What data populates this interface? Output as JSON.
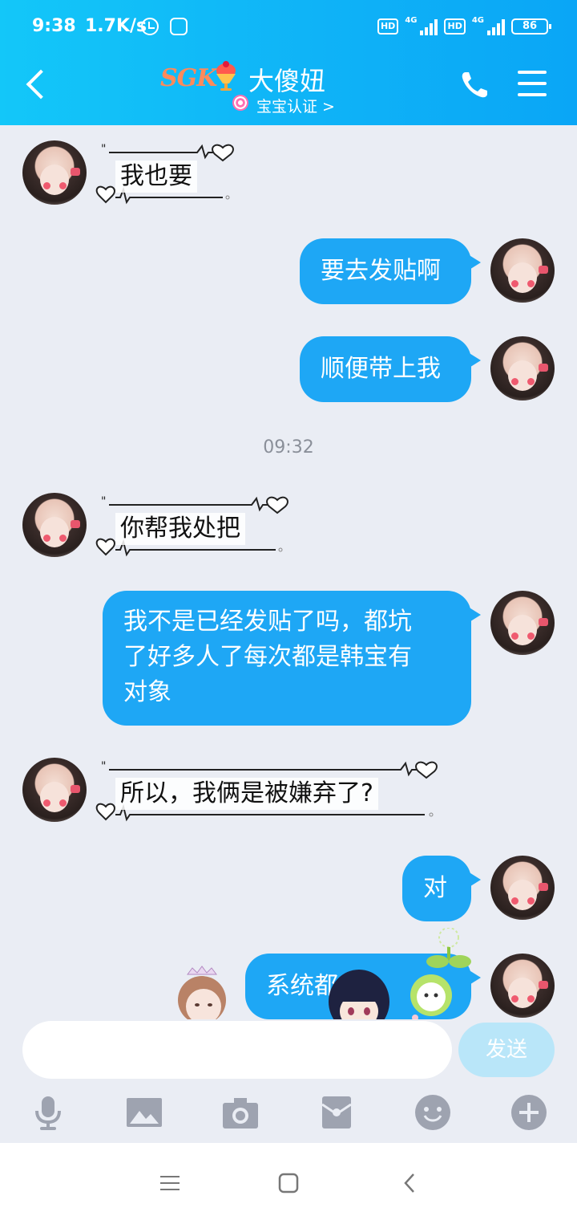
{
  "status_bar": {
    "time": "9:38",
    "speed": "1.7K/s",
    "network_left": "4G",
    "network_right": "4G",
    "battery": "86"
  },
  "header": {
    "brand": "SGK",
    "contact_name": "大傻妞",
    "verify_label": "宝宝认证 >"
  },
  "messages": {
    "m1": "我也要",
    "m2": "要去发贴啊",
    "m3": "顺便带上我",
    "time1": "09:32",
    "m4": "你帮我处把",
    "m5_line1": "我不是已经发贴了吗，都坑",
    "m5_line2": "了好多人了每次都是韩宝有",
    "m5_line3": "对象",
    "m6": "所以，我俩是被嫌弃了?",
    "m7": "对",
    "m8": "系统都"
  },
  "input": {
    "placeholder": "",
    "send_label": "发送"
  },
  "colors": {
    "header": "#13c7f9",
    "bubble": "#1ea7f5",
    "chat_bg": "#eaedf4"
  }
}
